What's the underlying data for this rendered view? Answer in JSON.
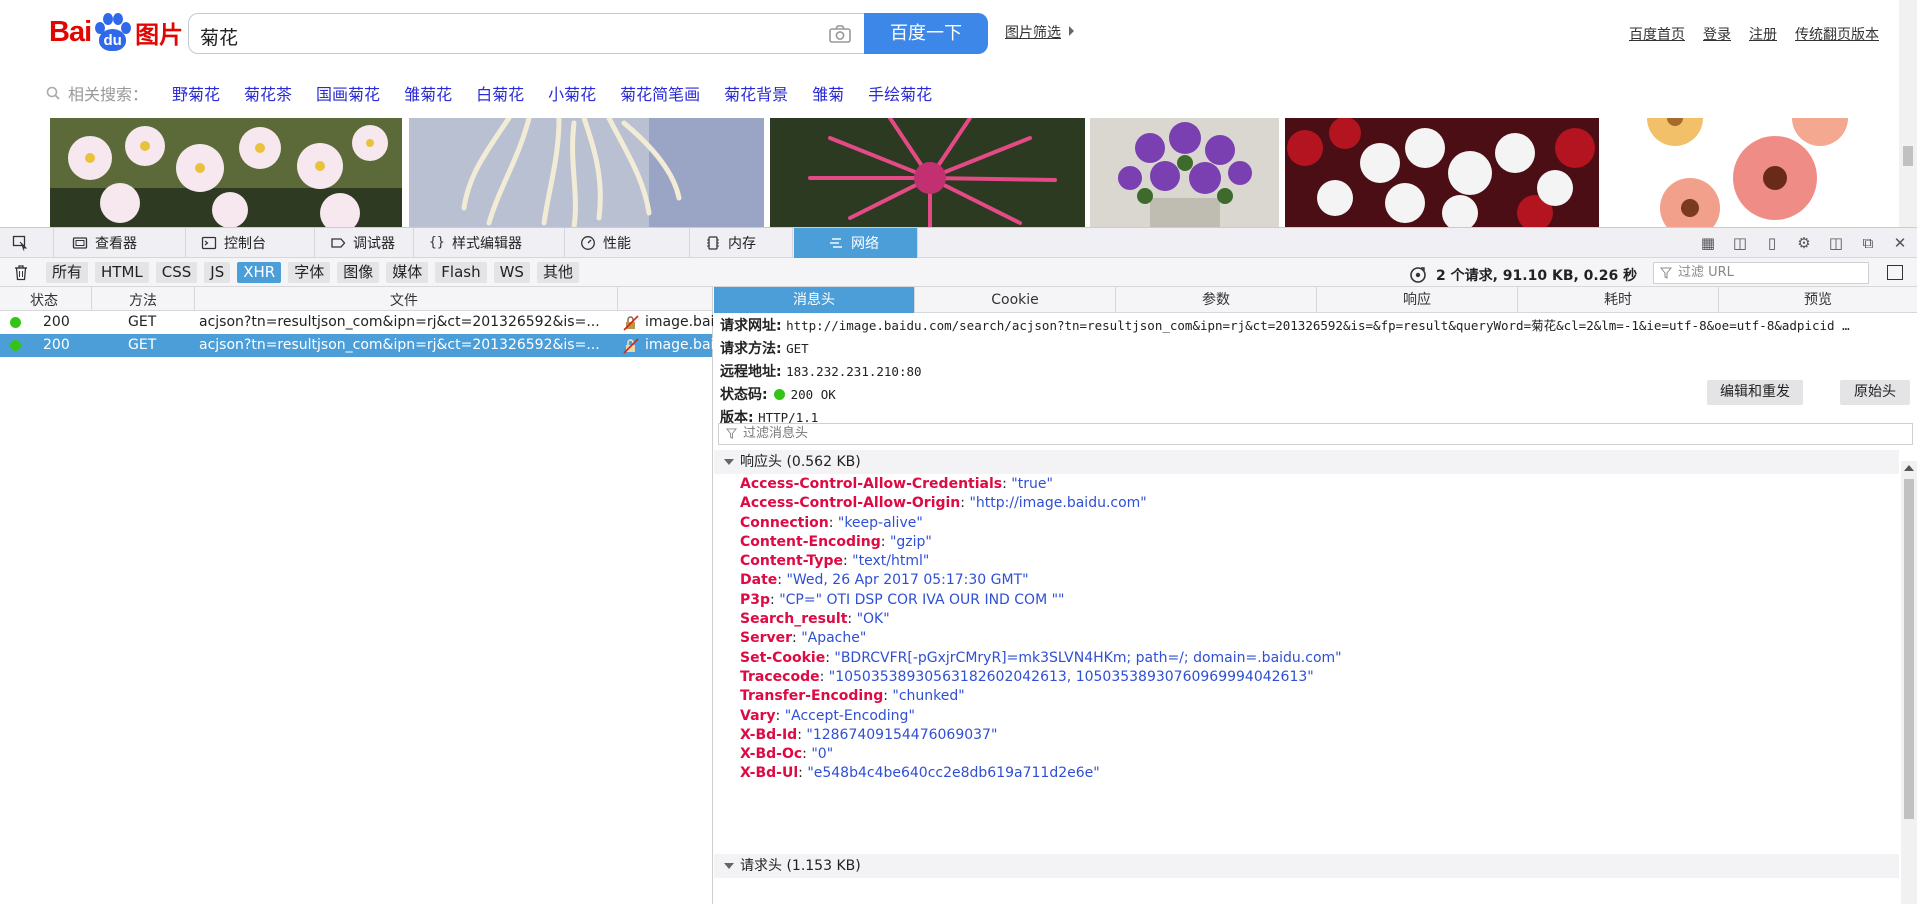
{
  "page": {
    "logo": {
      "bai": "Bai",
      "du": "du",
      "pic": "图片"
    },
    "search": {
      "query": "菊花",
      "button": "百度一下"
    },
    "pic_filter": "图片筛选",
    "top_links": [
      "百度首页",
      "登录",
      "注册",
      "传统翻页版本"
    ],
    "related": {
      "label": "相关搜索：",
      "keywords": [
        "野菊花",
        "菊花茶",
        "国画菊花",
        "雏菊花",
        "白菊花",
        "小菊花",
        "菊花简笔画",
        "菊花背景",
        "雏菊",
        "手绘菊花"
      ]
    },
    "feedback_icon": "!"
  },
  "devtools": {
    "tabs": [
      {
        "label": "查看器",
        "icon": "inspector-icon"
      },
      {
        "label": "控制台",
        "icon": "console-icon"
      },
      {
        "label": "调试器",
        "icon": "debugger-icon"
      },
      {
        "label": "样式编辑器",
        "icon": "style-editor-icon"
      },
      {
        "label": "性能",
        "icon": "performance-icon"
      },
      {
        "label": "内存",
        "icon": "memory-icon"
      },
      {
        "label": "网络",
        "icon": "network-icon"
      }
    ],
    "selected_tab": "网络",
    "filters": [
      "所有",
      "HTML",
      "CSS",
      "JS",
      "XHR",
      "字体",
      "图像",
      "媒体",
      "Flash",
      "WS",
      "其他"
    ],
    "active_filter": "XHR",
    "summary": "2 个请求, 91.10 KB, 0.26 秒",
    "url_filter_placeholder": "过滤 URL",
    "columns": {
      "status": "状态",
      "method": "方法",
      "file": "文件"
    },
    "requests": [
      {
        "status": "200",
        "method": "GET",
        "file": "acjson?tn=resultjson_com&ipn=rj&ct=201326592&is=...",
        "domain": "image.baidu.com"
      },
      {
        "status": "200",
        "method": "GET",
        "file": "acjson?tn=resultjson_com&ipn=rj&ct=201326592&is=...",
        "domain": "image.baidu.com"
      }
    ],
    "detail_tabs": [
      "消息头",
      "Cookie",
      "参数",
      "响应",
      "耗时",
      "预览"
    ],
    "selected_detail_tab": "消息头",
    "request_summary": {
      "url_label": "请求网址:",
      "url": "http://image.baidu.com/search/acjson?tn=resultjson_com&ipn=rj&ct=201326592&is=&fp=result&queryWord=菊花&cl=2&lm=-1&ie=utf-8&oe=utf-8&adpicid …",
      "method_label": "请求方法:",
      "method": "GET",
      "remote_label": "远程地址:",
      "remote": "183.232.231.210:80",
      "status_label": "状态码:",
      "status": "200 OK",
      "version_label": "版本:",
      "version": "HTTP/1.1"
    },
    "edit_resend": "编辑和重发",
    "raw_headers": "原始头",
    "header_filter_placeholder": "过滤消息头",
    "response_headers_title": "响应头 (0.562 KB)",
    "response_headers": [
      {
        "k": "Access-Control-Allow-Credentials",
        "v": "\"true\""
      },
      {
        "k": "Access-Control-Allow-Origin",
        "v": "\"http://image.baidu.com\""
      },
      {
        "k": "Connection",
        "v": "\"keep-alive\""
      },
      {
        "k": "Content-Encoding",
        "v": "\"gzip\""
      },
      {
        "k": "Content-Type",
        "v": "\"text/html\""
      },
      {
        "k": "Date",
        "v": "\"Wed, 26 Apr 2017 05:17:30 GMT\""
      },
      {
        "k": "P3p",
        "v": "\"CP=\" OTI DSP COR IVA OUR IND COM \"\""
      },
      {
        "k": "Search_result",
        "v": "\"OK\""
      },
      {
        "k": "Server",
        "v": "\"Apache\""
      },
      {
        "k": "Set-Cookie",
        "v": "\"BDRCVFR[-pGxjrCMryR]=mk3SLVN4HKm; path=/; domain=.baidu.com\""
      },
      {
        "k": "Tracecode",
        "v": "\"10503538930563182602042613, 10503538930760969994042613\""
      },
      {
        "k": "Transfer-Encoding",
        "v": "\"chunked\""
      },
      {
        "k": "Vary",
        "v": "\"Accept-Encoding\""
      },
      {
        "k": "X-Bd-Id",
        "v": "\"12867409154476069037\""
      },
      {
        "k": "X-Bd-Oc",
        "v": "\"0\""
      },
      {
        "k": "X-Bd-Ul",
        "v": "\"e548b4c4be640cc2e8db619a711d2e6e\""
      }
    ],
    "request_headers_title": "请求头 (1.153 KB)"
  },
  "colors": {
    "accent": "#4c9ed9",
    "baidu_red": "#e10602",
    "baidu_blue": "#2f68e8",
    "header_key": "#dd0a43",
    "header_value": "#2f4fd4",
    "status_ok": "#35c31a"
  }
}
